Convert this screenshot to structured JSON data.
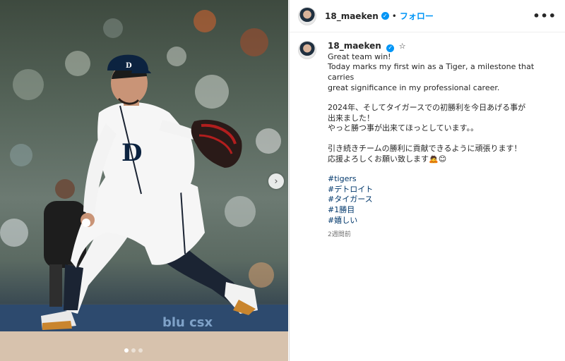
{
  "post": {
    "username": "18_maeken",
    "follow_label": "フォロー",
    "separator": "•",
    "more_icon": "•••",
    "star": "☆",
    "next_arrow": "›",
    "caption_lines": [
      "Great team win!",
      "Today marks my first win as a Tiger, a milestone that carries",
      "great significance in my professional career."
    ],
    "caption_jp_1": [
      "2024年、そしてタイガースでの初勝利を今日あげる事が",
      "出来ました！",
      "やっと勝つ事が出来てほっとしています。。"
    ],
    "caption_jp_2": [
      "引き続きチームの勝利に貢献できるように頑張ります！",
      "応援よろしくお願い致します🙇😊"
    ],
    "hashtags": [
      "#tigers",
      "#デトロイト",
      "#タイガース",
      "#1勝目",
      "#嬉しい"
    ],
    "timestamp": "2週間前"
  },
  "icons": {
    "verified": "verified-badge-icon",
    "more": "more-options-icon",
    "next": "chevron-right-icon"
  },
  "colors": {
    "link_blue": "#0095f6",
    "hashtag": "#00376b",
    "muted": "#737373"
  }
}
